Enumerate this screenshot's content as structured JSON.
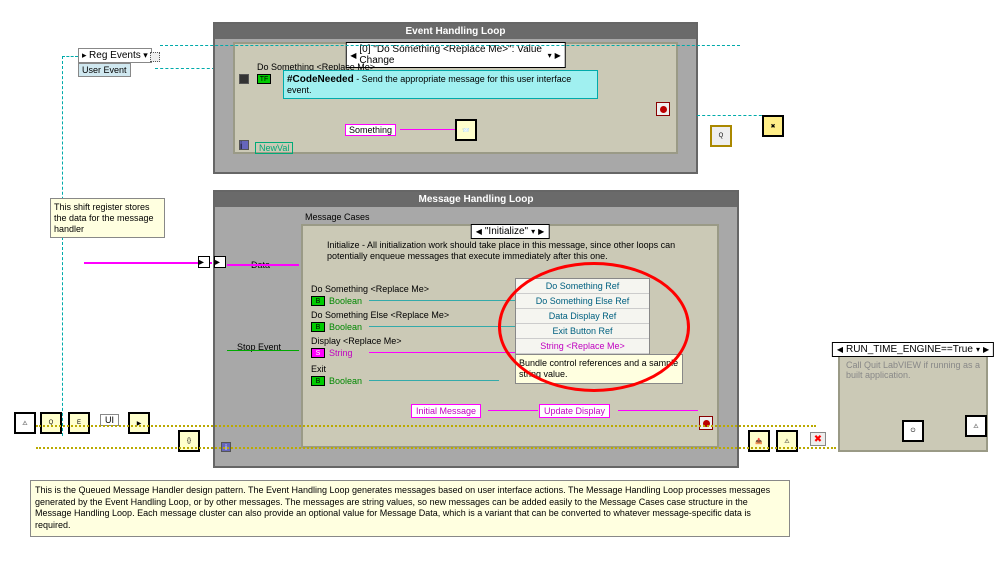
{
  "regEvents": "Reg Events",
  "userEvent": "User Event",
  "evtLoop": {
    "title": "Event Handling Loop",
    "caseLabel": "[0] \"Do Something <Replace Me>\": Value Change",
    "doSomething": "Do Something <Replace Me>",
    "codeNeeded": "#CodeNeeded - Send the appropriate message for this user interface event.",
    "something": "Something",
    "newVal": "NewVal"
  },
  "shiftNote": "This shift register stores the data for the message handler",
  "msgLoop": {
    "title": "Message Handling Loop",
    "casesLabel": "Message Cases",
    "initCase": "\"Initialize\"",
    "initDesc": "Initialize - All initialization work should take place in this message, since other loops can potentially enqueue messages that execute immediately after this one.",
    "data": "Data",
    "doSomething": "Do Something <Replace Me>",
    "doElse": "Do Something Else <Replace Me>",
    "display": "Display <Replace Me>",
    "exit": "Exit",
    "bool": "Boolean",
    "str": "String",
    "stopEvt": "Stop Event",
    "initMsg": "Initial Message",
    "updateDisp": "Update Display",
    "bundleNote": "Bundle control references and a sample string value."
  },
  "bundle": {
    "i0": "Do Something Ref",
    "i1": "Do Something Else Ref",
    "i2": "Data Display Ref",
    "i3": "Exit Button Ref",
    "i4": "String <Replace Me>"
  },
  "ui": "UI",
  "runCase": {
    "label": "RUN_TIME_ENGINE==True",
    "desc": "Call Quit LabVIEW if running as a built application."
  },
  "bottom": "This is the Queued Message Handler design pattern. The Event Handling Loop generates messages based on user interface actions. The Message Handling Loop processes messages generated by the Event Handling Loop, or by other messages.  The messages are string values, so new messages can be added easily to the Message Cases case structure in the Message Handling Loop.  Each message cluster can also provide an optional value for Message Data, which is a variant that can be converted to whatever message-specific data is required."
}
